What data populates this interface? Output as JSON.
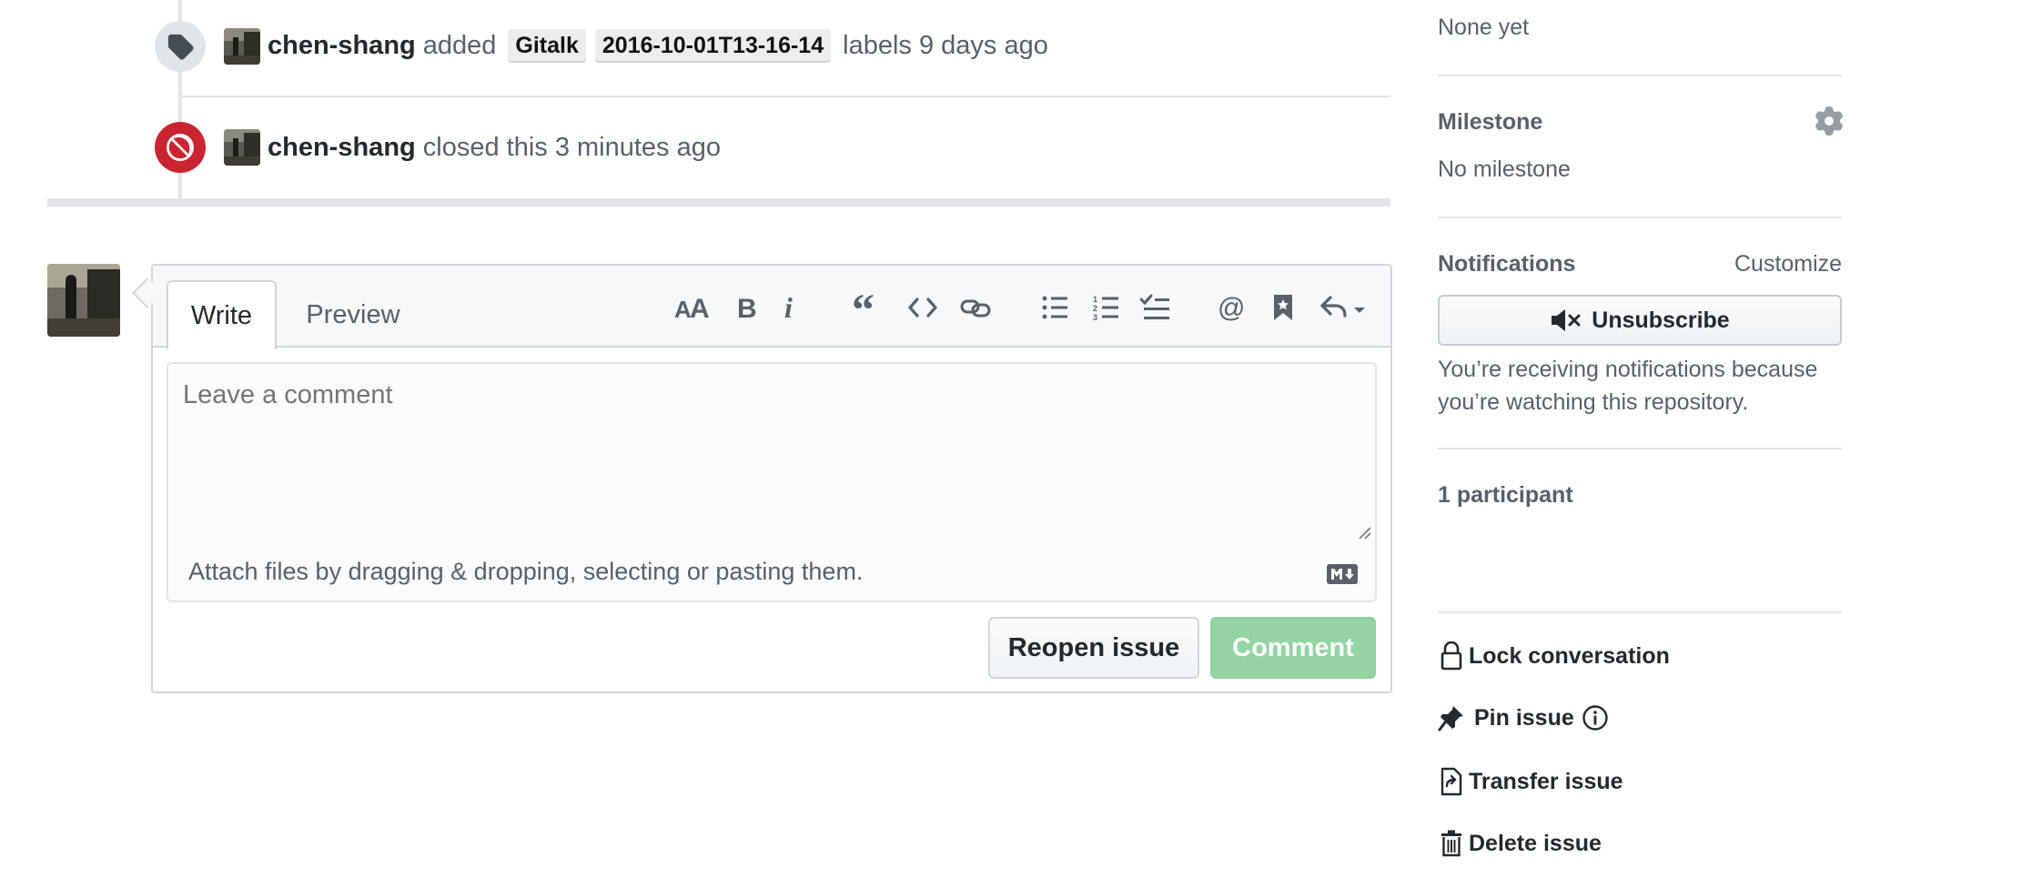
{
  "timeline": {
    "labeled_event": {
      "actor": "chen-shang",
      "verb": "added",
      "labels": [
        "Gitalk",
        "2016-10-01T13-16-14"
      ],
      "suffix": "labels 9 days ago"
    },
    "closed_event": {
      "actor": "chen-shang",
      "text": "closed this 3 minutes ago"
    }
  },
  "comment_form": {
    "tabs": [
      {
        "label": "Write"
      },
      {
        "label": "Preview"
      }
    ],
    "toolbar_icons": [
      "text-size-icon",
      "bold-icon",
      "italic-icon",
      "quote-icon",
      "code-icon",
      "link-icon",
      "bullet-list-icon",
      "numbered-list-icon",
      "task-list-icon",
      "mention-icon",
      "reference-icon",
      "reply-icon"
    ],
    "textarea_placeholder": "Leave a comment",
    "attach_text": "Attach files by dragging & dropping, selecting or pasting them.",
    "reopen_label": "Reopen issue",
    "comment_label": "Comment"
  },
  "sidebar": {
    "labels_value": "None yet",
    "milestone": {
      "heading": "Milestone",
      "value": "No milestone"
    },
    "notifications": {
      "heading": "Notifications",
      "customize": "Customize",
      "unsubscribe": "Unsubscribe",
      "reason_line1": "You’re receiving notifications because",
      "reason_line2": "you’re watching this repository."
    },
    "participants": {
      "heading": "1 participant"
    },
    "actions": {
      "lock": "Lock conversation",
      "pin": "Pin issue",
      "transfer": "Transfer issue",
      "delete": "Delete issue"
    }
  },
  "colors": {
    "closed_badge": "#cb2431",
    "comment_button": "#94d3a2",
    "link": "#0366d6"
  }
}
